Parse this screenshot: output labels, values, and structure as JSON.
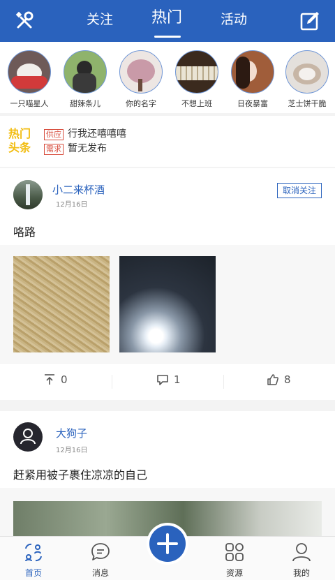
{
  "colors": {
    "brand": "#2a62bd",
    "tag": "#d74a3a",
    "news_logo": "#f2bd12"
  },
  "header": {
    "left_icon": "tools-icon",
    "right_icon": "edit-icon",
    "tabs": [
      {
        "label": "关注"
      },
      {
        "label": "热门",
        "active": true
      },
      {
        "label": "活动"
      }
    ]
  },
  "stories": [
    {
      "name": "一只喵星人"
    },
    {
      "name": "甜辣条儿"
    },
    {
      "name": "你的名字"
    },
    {
      "name": "不想上班"
    },
    {
      "name": "日夜暴富"
    },
    {
      "name": "芝士饼干脆"
    }
  ],
  "news": {
    "logo_line1": "热门",
    "logo_line2": "头条",
    "items": [
      {
        "tag": "供应",
        "text": "行我还嘻嘻嘻"
      },
      {
        "tag": "需求",
        "text": "暂无发布"
      }
    ]
  },
  "posts": [
    {
      "user": "小二来杯酒",
      "date": "12月16日",
      "follow_label": "取消关注",
      "text": "咯路",
      "shares": "0",
      "comments": "1",
      "likes": "8"
    },
    {
      "user": "大狗子",
      "date": "12月16日",
      "text": "赶紧用被子裹住凉凉的自己"
    }
  ],
  "tabbar": {
    "items": [
      {
        "label": "首页",
        "icon": "home-icon",
        "active": true
      },
      {
        "label": "消息",
        "icon": "message-icon"
      },
      {
        "label": "资源",
        "icon": "grid-icon"
      },
      {
        "label": "我的",
        "icon": "profile-icon"
      }
    ],
    "fab_icon": "plus-icon"
  }
}
